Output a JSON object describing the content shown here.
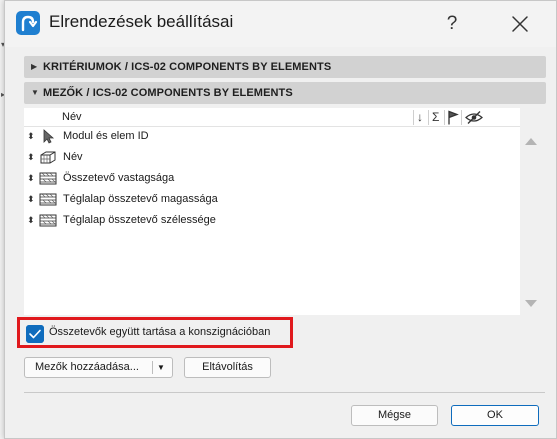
{
  "window": {
    "title": "Elrendezések beállításai",
    "help_glyph": "?"
  },
  "sections": {
    "criteria": {
      "label": "KRITÉRIUMOK / ICS-02 COMPONENTS BY ELEMENTS",
      "state": "collapsed"
    },
    "fields": {
      "label": "MEZŐK / ICS-02 COMPONENTS BY ELEMENTS",
      "state": "expanded"
    }
  },
  "list": {
    "column_name": "Név",
    "header_icons": [
      {
        "icon": "sort-arrow-icon",
        "glyph": "↓"
      },
      {
        "icon": "sum-icon",
        "glyph": "Σ"
      },
      {
        "icon": "flag-icon",
        "glyph": ""
      },
      {
        "icon": "hidden-eye-icon",
        "glyph": ""
      }
    ],
    "rows": [
      {
        "label": "Modul és elem ID",
        "icon": "cursor-arrow-icon"
      },
      {
        "label": "Név",
        "icon": "3d-block-icon"
      },
      {
        "label": "Összetevő vastagsága",
        "icon": "hatch-layers-icon"
      },
      {
        "label": "Téglalap összetevő magassága",
        "icon": "hatch-layers-icon"
      },
      {
        "label": "Téglalap összetevő szélessége",
        "icon": "hatch-layers-icon"
      }
    ]
  },
  "options": {
    "keep_components_together": {
      "label": "Összetevők együtt tartása a konszignációban",
      "checked": true
    }
  },
  "buttons": {
    "add_fields": "Mezők hozzáadása...",
    "remove": "Eltávolítás",
    "cancel": "Mégse",
    "ok": "OK"
  },
  "colors": {
    "accent": "#0f6cbd",
    "highlight_border": "#e0191d",
    "section_header_bg": "#d2d2d2",
    "dialog_bg": "#f0f0f0"
  }
}
